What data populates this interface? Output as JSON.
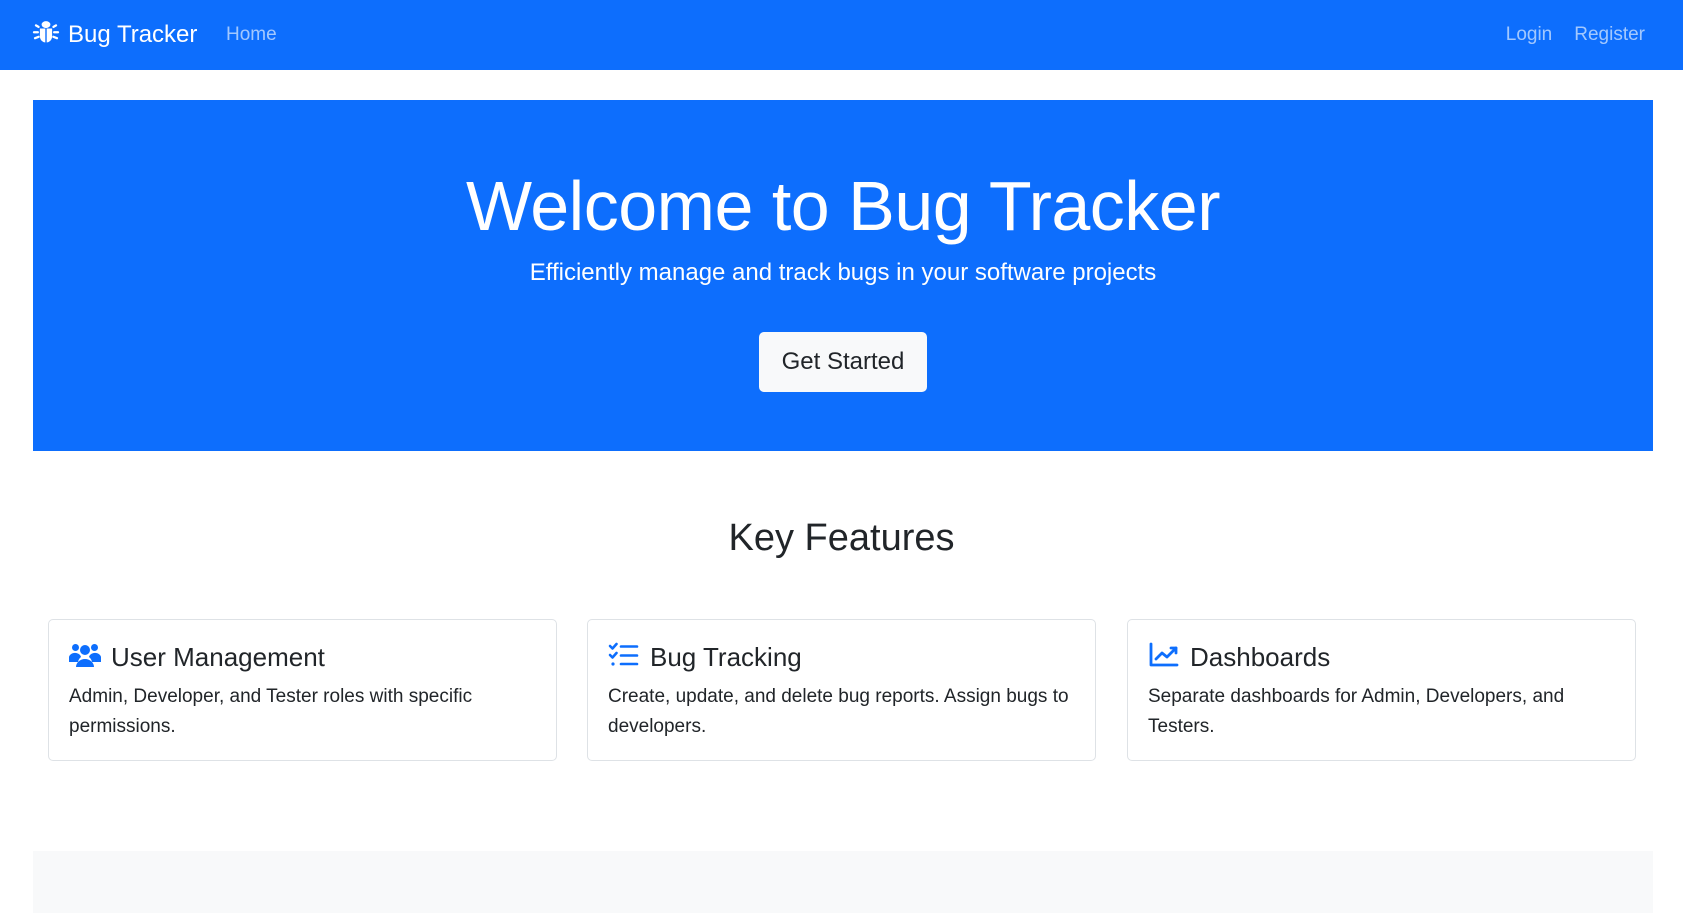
{
  "navbar": {
    "brand": "Bug Tracker",
    "brand_icon": "bug-icon",
    "home": "Home",
    "login": "Login",
    "register": "Register"
  },
  "hero": {
    "title": "Welcome to Bug Tracker",
    "subtitle": "Efficiently manage and track bugs in your software projects",
    "cta": "Get Started"
  },
  "features": {
    "heading": "Key Features",
    "cards": [
      {
        "icon": "users-icon",
        "title": "User Management",
        "text": "Admin, Developer, and Tester roles with specific permissions."
      },
      {
        "icon": "tasks-icon",
        "title": "Bug Tracking",
        "text": "Create, update, and delete bug reports. Assign bugs to developers."
      },
      {
        "icon": "chart-line-icon",
        "title": "Dashboards",
        "text": "Separate dashboards for Admin, Developers, and Testers."
      }
    ]
  },
  "colors": {
    "primary": "#0d6efd",
    "light": "#f8f9fa",
    "text": "#212529",
    "border": "#dee2e6"
  }
}
